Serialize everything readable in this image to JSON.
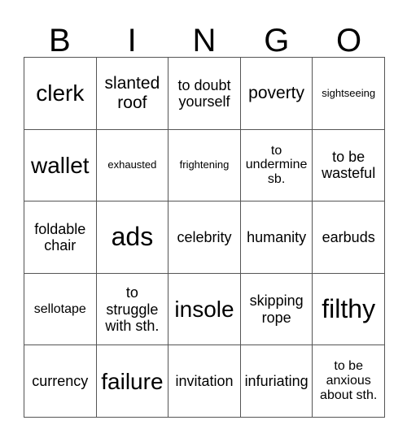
{
  "card": {
    "header_letters": [
      "B",
      "I",
      "N",
      "G",
      "O"
    ],
    "colors": {
      "background": "#ffffff",
      "text": "#000000",
      "grid_line": "#555555"
    },
    "rows": [
      [
        {
          "text": "clerk",
          "size": "fs-xl"
        },
        {
          "text": "slanted roof",
          "size": "fs-lg"
        },
        {
          "text": "to doubt yourself",
          "size": "fs-md"
        },
        {
          "text": "poverty",
          "size": "fs-lg"
        },
        {
          "text": "sightseeing",
          "size": "fs-xs"
        }
      ],
      [
        {
          "text": "wallet",
          "size": "fs-xl"
        },
        {
          "text": "exhausted",
          "size": "fs-xs"
        },
        {
          "text": "frightening",
          "size": "fs-xs"
        },
        {
          "text": "to undermine sb.",
          "size": "fs-sm"
        },
        {
          "text": "to be wasteful",
          "size": "fs-md"
        }
      ],
      [
        {
          "text": "foldable chair",
          "size": "fs-md"
        },
        {
          "text": "ads",
          "size": "fs-xxl"
        },
        {
          "text": "celebrity",
          "size": "fs-md"
        },
        {
          "text": "humanity",
          "size": "fs-md"
        },
        {
          "text": "earbuds",
          "size": "fs-md"
        }
      ],
      [
        {
          "text": "sellotape",
          "size": "fs-sm"
        },
        {
          "text": "to struggle with sth.",
          "size": "fs-md"
        },
        {
          "text": "insole",
          "size": "fs-xl"
        },
        {
          "text": "skipping rope",
          "size": "fs-md"
        },
        {
          "text": "filthy",
          "size": "fs-xxl"
        }
      ],
      [
        {
          "text": "currency",
          "size": "fs-md"
        },
        {
          "text": "failure",
          "size": "fs-xl"
        },
        {
          "text": "invitation",
          "size": "fs-md"
        },
        {
          "text": "infuriating",
          "size": "fs-md"
        },
        {
          "text": "to be anxious about sth.",
          "size": "fs-sm"
        }
      ]
    ]
  }
}
